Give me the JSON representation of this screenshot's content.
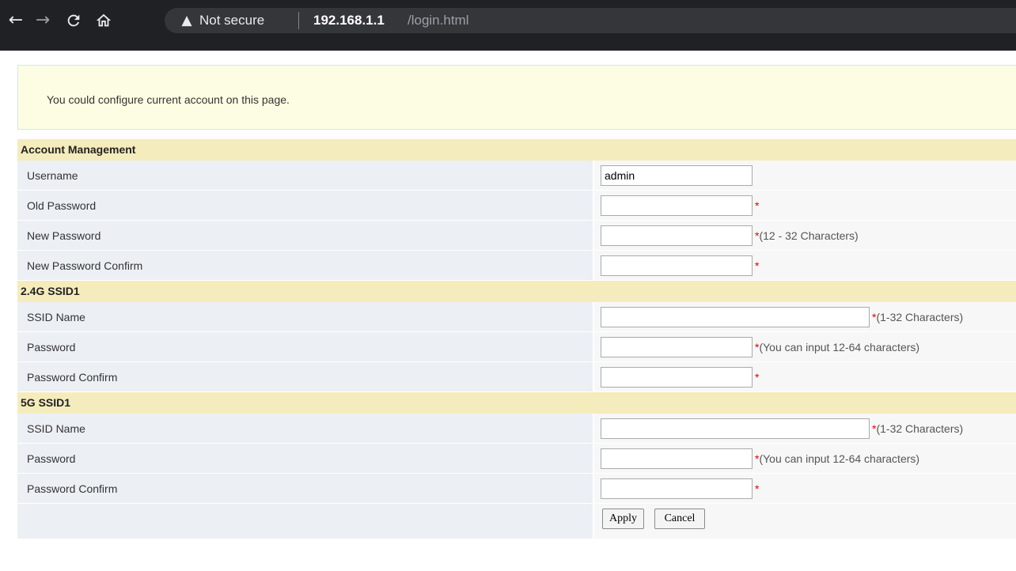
{
  "browser": {
    "security_label": "Not secure",
    "url_host": "192.168.1.1",
    "url_path": "/login.html"
  },
  "notice": "You could configure current account on this page.",
  "sections": {
    "account": {
      "title": "Account Management",
      "username_label": "Username",
      "username_value": "admin",
      "old_password_label": "Old Password",
      "new_password_label": "New Password",
      "new_password_hint": "(12 - 32 Characters)",
      "new_password_confirm_label": "New Password Confirm"
    },
    "ssid24": {
      "title": "2.4G SSID1",
      "ssid_name_label": "SSID Name",
      "ssid_name_hint": "(1-32 Characters)",
      "password_label": "Password",
      "password_hint": "(You can input 12-64 characters)",
      "password_confirm_label": "Password Confirm"
    },
    "ssid5": {
      "title": "5G SSID1",
      "ssid_name_label": "SSID Name",
      "ssid_name_hint": "(1-32 Characters)",
      "password_label": "Password",
      "password_hint": "(You can input 12-64 characters)",
      "password_confirm_label": "Password Confirm"
    }
  },
  "required_mark": "*",
  "buttons": {
    "apply": "Apply",
    "cancel": "Cancel"
  },
  "icons": {
    "back": "arrow-left-icon",
    "forward": "arrow-right-icon",
    "reload": "reload-icon",
    "home": "home-icon",
    "warning": "warning-triangle-icon"
  }
}
